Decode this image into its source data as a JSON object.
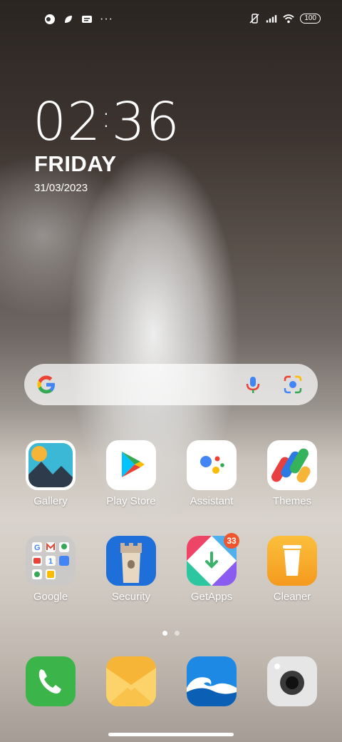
{
  "status_bar": {
    "battery": "100",
    "left_icons": [
      "status-app-icon",
      "leaf-icon",
      "message-icon",
      "more-dots-icon"
    ],
    "right_icons": [
      "mute-icon",
      "signal-icon",
      "wifi-icon",
      "battery-icon"
    ]
  },
  "clock": {
    "time_hours": "02",
    "time_minutes": "36",
    "day": "FRIDAY",
    "date": "31/03/2023"
  },
  "search": {
    "icons": [
      "google-g-icon",
      "microphone-icon",
      "google-lens-icon"
    ]
  },
  "apps": [
    {
      "label": "Gallery",
      "icon": "gallery-icon"
    },
    {
      "label": "Play Store",
      "icon": "play-store-icon"
    },
    {
      "label": "Assistant",
      "icon": "assistant-icon"
    },
    {
      "label": "Themes",
      "icon": "themes-icon"
    },
    {
      "label": "Google",
      "icon": "google-folder-icon"
    },
    {
      "label": "Security",
      "icon": "security-icon"
    },
    {
      "label": "GetApps",
      "icon": "getapps-icon",
      "badge": "33"
    },
    {
      "label": "Cleaner",
      "icon": "cleaner-icon"
    }
  ],
  "dock": [
    {
      "icon": "phone-icon"
    },
    {
      "icon": "messaging-icon"
    },
    {
      "icon": "browser-icon"
    },
    {
      "icon": "camera-icon"
    }
  ],
  "pager": {
    "pages": 2,
    "current": 1
  },
  "colors": {
    "badge": "#f0552e",
    "phone": "#3bb54a",
    "messaging": "#f7b538",
    "browser": "#1e88e5"
  }
}
